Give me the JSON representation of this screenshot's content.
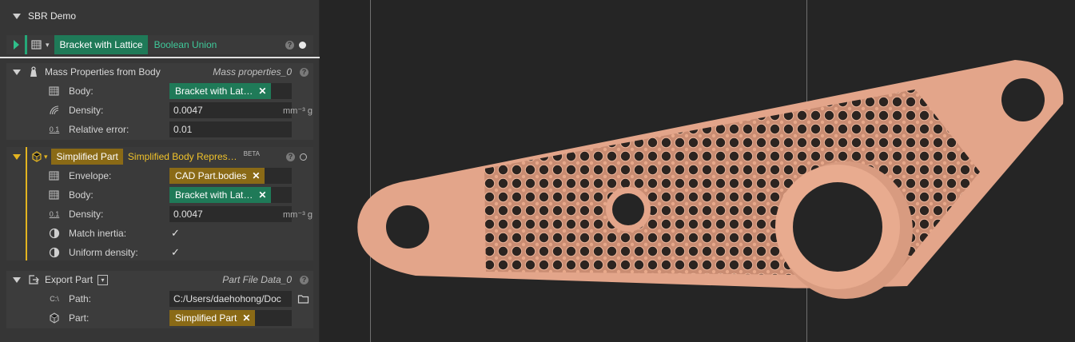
{
  "panel": {
    "title": "SBR Demo",
    "bracket": {
      "name": "Bracket with Lattice",
      "type": "Boolean Union",
      "help": "?"
    },
    "mass": {
      "name": "Mass Properties from Body",
      "output": "Mass properties_0",
      "help": "?",
      "body_label": "Body:",
      "body_value": "Bracket with Lat…",
      "density_label": "Density:",
      "density_value": "0.0047",
      "density_unit": "mm⁻³ g",
      "error_label": "Relative error:",
      "error_value": "0.01"
    },
    "simplified": {
      "name": "Simplified Part",
      "type": "Simplified Body Repres…",
      "badge": "BETA",
      "help": "?",
      "envelope_label": "Envelope:",
      "envelope_value": "CAD Part.bodies",
      "body_label": "Body:",
      "body_value": "Bracket with Lat…",
      "density_label": "Density:",
      "density_value": "0.0047",
      "density_unit": "mm⁻³ g",
      "inertia_label": "Match inertia:",
      "uniform_label": "Uniform density:",
      "check": "✓"
    },
    "export": {
      "name": "Export Part",
      "output": "Part File Data_0",
      "help": "?",
      "path_label": "Path:",
      "path_value": "C:/Users/daehohong/Doc",
      "part_label": "Part:",
      "part_value": "Simplified Part"
    },
    "icons": {
      "x": "✕",
      "path_prefix": "C:\\",
      "num_prefix": "0.1"
    }
  },
  "colors": {
    "green_accent": "#1f7a58",
    "gold_accent": "#8a6a16",
    "part_color": "#e3a58a"
  }
}
